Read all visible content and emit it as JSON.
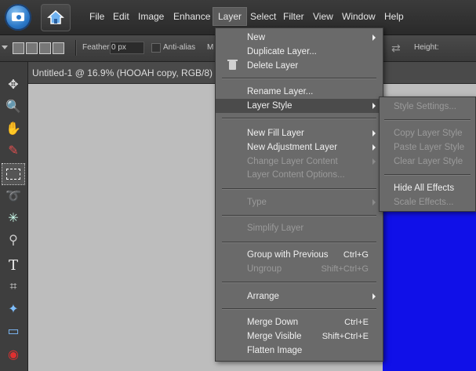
{
  "menubar": {
    "items": [
      {
        "label": "File"
      },
      {
        "label": "Edit"
      },
      {
        "label": "Image"
      },
      {
        "label": "Enhance"
      },
      {
        "label": "Layer"
      },
      {
        "label": "Select"
      },
      {
        "label": "Filter"
      },
      {
        "label": "View"
      },
      {
        "label": "Window"
      },
      {
        "label": "Help"
      }
    ],
    "active": "Layer"
  },
  "options_bar": {
    "feather_label": "Feather:",
    "feather_value": "0 px",
    "antialias_label": "Anti-alias",
    "mode_letter": "M",
    "height_label": "Height:"
  },
  "document": {
    "tab_title": "Untitled-1 @ 16.9% (HOOAH copy, RGB/8)",
    "canvas_color": "#1010e8"
  },
  "layer_menu": {
    "items": [
      {
        "label": "New",
        "shortcut": "",
        "submenu": true,
        "disabled": false
      },
      {
        "label": "Duplicate Layer...",
        "shortcut": "",
        "submenu": false,
        "disabled": false
      },
      {
        "label": "Delete Layer",
        "shortcut": "",
        "submenu": false,
        "disabled": false,
        "icon": "trash-icon"
      },
      {
        "label": "Rename Layer...",
        "shortcut": "",
        "submenu": false,
        "disabled": false
      },
      {
        "label": "Layer Style",
        "shortcut": "",
        "submenu": true,
        "disabled": false,
        "highlighted": true
      },
      {
        "label": "New Fill Layer",
        "shortcut": "",
        "submenu": true,
        "disabled": false
      },
      {
        "label": "New Adjustment Layer",
        "shortcut": "",
        "submenu": true,
        "disabled": false
      },
      {
        "label": "Change Layer Content",
        "shortcut": "",
        "submenu": true,
        "disabled": true
      },
      {
        "label": "Layer Content Options...",
        "shortcut": "",
        "submenu": false,
        "disabled": true
      },
      {
        "label": "Type",
        "shortcut": "",
        "submenu": true,
        "disabled": true
      },
      {
        "label": "Simplify Layer",
        "shortcut": "",
        "submenu": false,
        "disabled": true
      },
      {
        "label": "Group with Previous",
        "shortcut": "Ctrl+G",
        "submenu": false,
        "disabled": false
      },
      {
        "label": "Ungroup",
        "shortcut": "Shift+Ctrl+G",
        "submenu": false,
        "disabled": true
      },
      {
        "label": "Arrange",
        "shortcut": "",
        "submenu": true,
        "disabled": false
      },
      {
        "label": "Merge Down",
        "shortcut": "Ctrl+E",
        "submenu": false,
        "disabled": false
      },
      {
        "label": "Merge Visible",
        "shortcut": "Shift+Ctrl+E",
        "submenu": false,
        "disabled": false
      },
      {
        "label": "Flatten Image",
        "shortcut": "",
        "submenu": false,
        "disabled": false
      }
    ]
  },
  "layer_style_submenu": {
    "items": [
      {
        "label": "Style Settings...",
        "disabled": true
      },
      {
        "label": "Copy Layer Style",
        "disabled": true
      },
      {
        "label": "Paste Layer Style",
        "disabled": true
      },
      {
        "label": "Clear Layer Style",
        "disabled": true
      },
      {
        "label": "Hide All Effects",
        "disabled": false
      },
      {
        "label": "Scale Effects...",
        "disabled": true
      }
    ]
  },
  "toolbox": {
    "tools": [
      "move-tool-icon",
      "zoom-tool-icon",
      "hand-tool-icon",
      "eyedropper-tool-icon",
      "marquee-tool-icon",
      "lasso-tool-icon",
      "magic-wand-tool-icon",
      "selection-brush-tool-icon",
      "type-tool-icon",
      "crop-tool-icon",
      "cookie-cutter-tool-icon",
      "straighten-tool-icon",
      "red-eye-tool-icon"
    ],
    "selected": "marquee-tool-icon"
  }
}
